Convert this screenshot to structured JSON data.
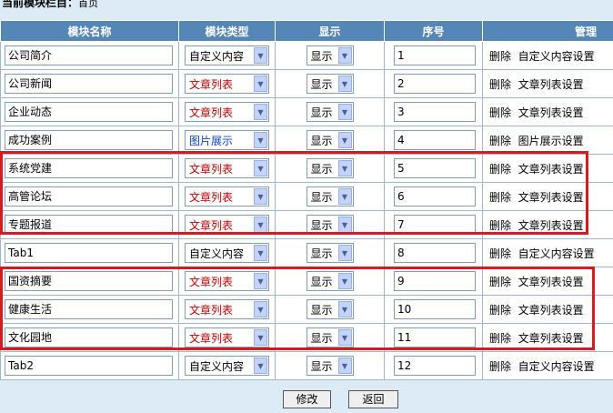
{
  "breadcrumb": {
    "label": "当前模块栏目：",
    "current": "首页"
  },
  "table": {
    "headers": [
      "模块名称",
      "模块类型",
      "显示",
      "序号",
      "管理"
    ],
    "rows": [
      {
        "name": "公司简介",
        "type": "自定义内容",
        "show": "显示",
        "order": "1",
        "delete": "删除",
        "setting": "自定义内容设置"
      },
      {
        "name": "公司新闻",
        "type": "文章列表",
        "show": "显示",
        "order": "2",
        "delete": "删除",
        "setting": "文章列表设置"
      },
      {
        "name": "企业动态",
        "type": "文章列表",
        "show": "显示",
        "order": "3",
        "delete": "删除",
        "setting": "文章列表设置"
      },
      {
        "name": "成功案例",
        "type": "图片展示",
        "show": "显示",
        "order": "4",
        "delete": "删除",
        "setting": "图片展示设置"
      },
      {
        "name": "系统党建",
        "type": "文章列表",
        "show": "显示",
        "order": "5",
        "delete": "删除",
        "setting": "文章列表设置"
      },
      {
        "name": "高管论坛",
        "type": "文章列表",
        "show": "显示",
        "order": "6",
        "delete": "删除",
        "setting": "文章列表设置"
      },
      {
        "name": "专题报道",
        "type": "文章列表",
        "show": "显示",
        "order": "7",
        "delete": "删除",
        "setting": "文章列表设置"
      },
      {
        "name": "Tab1",
        "type": "自定义内容",
        "show": "显示",
        "order": "8",
        "delete": "删除",
        "setting": "自定义内容设置"
      },
      {
        "name": "国资摘要",
        "type": "文章列表",
        "show": "显示",
        "order": "9",
        "delete": "删除",
        "setting": "文章列表设置"
      },
      {
        "name": "健康生活",
        "type": "文章列表",
        "show": "显示",
        "order": "10",
        "delete": "删除",
        "setting": "文章列表设置"
      },
      {
        "name": "文化园地",
        "type": "文章列表",
        "show": "显示",
        "order": "11",
        "delete": "删除",
        "setting": "文章列表设置"
      },
      {
        "name": "Tab2",
        "type": "自定义内容",
        "show": "显示",
        "order": "12",
        "delete": "删除",
        "setting": "自定义内容设置"
      }
    ]
  },
  "buttons": {
    "modify": "修改",
    "back": "返回"
  },
  "colors": {
    "header_bg": "#5486b7",
    "page_bg": "#dcebf6",
    "article_list_text": "#c00000",
    "image_show_text": "#0a46c8",
    "highlight": "#d9181f"
  },
  "icons": {
    "dropdown": "chevron-down-icon"
  }
}
